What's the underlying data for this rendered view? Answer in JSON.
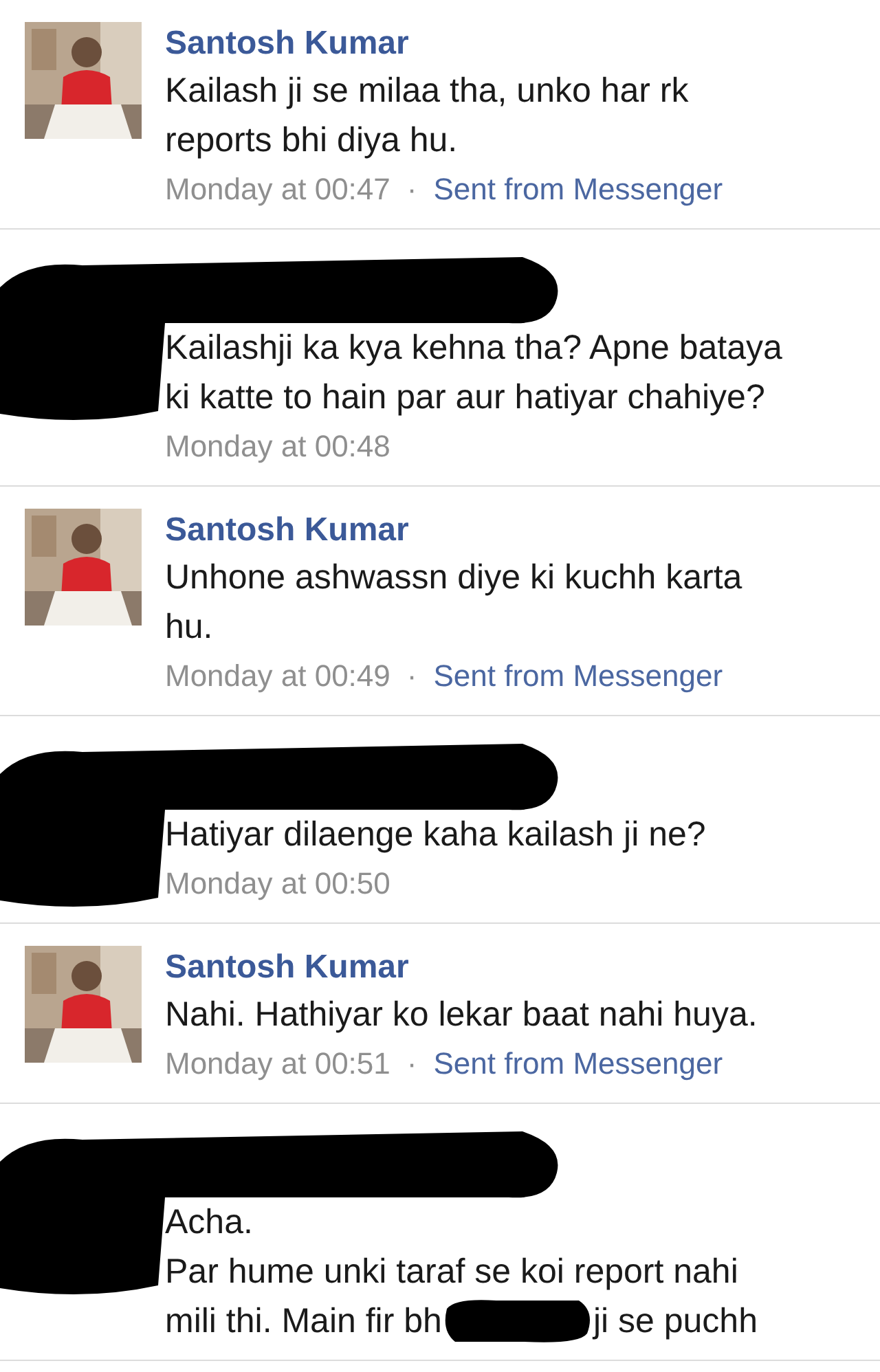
{
  "messages": [
    {
      "kind": "contact",
      "sender": "Santosh Kumar",
      "lines": [
        [
          "Kailash ji se milaa tha, unko har rk"
        ],
        [
          "reports bhi diya hu."
        ]
      ],
      "time": "Monday at 00:47",
      "separator": "·",
      "source": "Sent from Messenger"
    },
    {
      "kind": "redacted",
      "lines": [
        [
          "Kailashji ka kya kehna tha? Apne bataya"
        ],
        [
          "ki katte to hain par aur hatiyar chahiye?"
        ]
      ],
      "time": "Monday at 00:48"
    },
    {
      "kind": "contact",
      "sender": "Santosh Kumar",
      "lines": [
        [
          "Unhone ashwassn diye ki kuchh karta"
        ],
        [
          "hu."
        ]
      ],
      "time": "Monday at 00:49",
      "separator": "·",
      "source": "Sent from Messenger"
    },
    {
      "kind": "redacted",
      "lines": [
        [
          "Hatiyar dilaenge kaha kailash ji ne?"
        ]
      ],
      "time": "Monday at 00:50"
    },
    {
      "kind": "contact",
      "sender": "Santosh Kumar",
      "lines": [
        [
          "Nahi. Hathiyar ko lekar baat nahi huya."
        ]
      ],
      "time": "Monday at 00:51",
      "separator": "·",
      "source": "Sent from Messenger"
    },
    {
      "kind": "redacted",
      "lines": [
        [
          "Acha."
        ],
        [
          "Par hume unki taraf se koi report nahi"
        ],
        [
          "mili thi. Main fir bh",
          "ji se puchh"
        ]
      ]
    }
  ]
}
